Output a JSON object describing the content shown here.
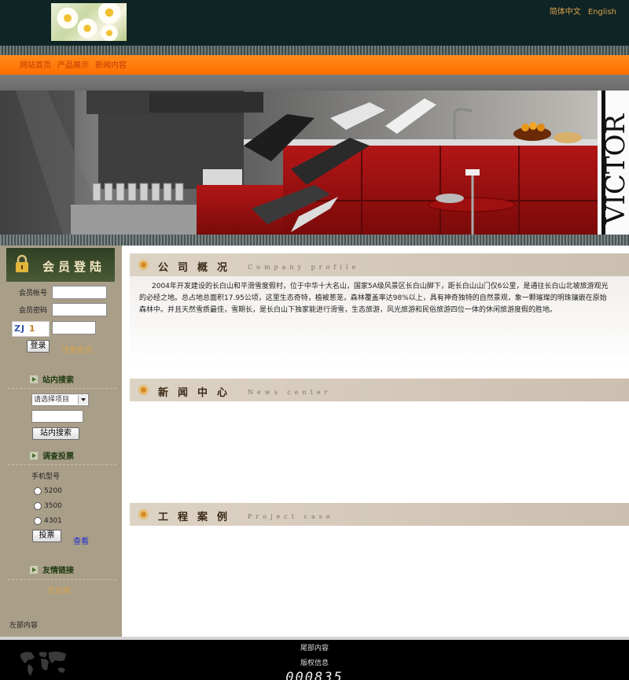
{
  "header": {
    "lang_cn": "简体中文",
    "lang_en": "English"
  },
  "nav": {
    "items": [
      "网站首页",
      "产品展示",
      "新闻内容"
    ]
  },
  "login": {
    "title": "会员登陆",
    "account_label": "会员帐号",
    "password_label": "会员密码",
    "captcha_text": "ZJ",
    "captcha_tail": "1",
    "login_button": "登录",
    "register_link": "注册会员"
  },
  "site_search": {
    "title": "站内搜索",
    "select_value": "请选择项目",
    "button": "站内搜索"
  },
  "survey": {
    "title": "调查投票",
    "question": "手机型号",
    "options": [
      "5200",
      "3500",
      "4301"
    ],
    "vote_button": "投票",
    "view_link": "查看"
  },
  "links": {
    "title": "友情链接",
    "item": "交友网"
  },
  "left_footer": "左部内容",
  "company": {
    "title": "公司概况",
    "subtitle": "Company profile",
    "text": "2004年开发建设的长白山和平滑雪度假村，位于中华十大名山，国家5A级风景区长白山脚下，距长白山山门仅6公里，是通往长白山北坡旅游观光的必经之地。总占地总面积17.95公顷，这里生态奇特，植被葱茏，森林覆盖率达98%以上，具有神奇独特的自然景观，象一颗璀璨的明珠镶嵌在原始森林中。并且天然雪质最佳，雪期长，是长白山下独家能进行滑雪，生态旅游，风光旅游和民俗旅游四位一体的休闲旅游度假的胜地。"
  },
  "news": {
    "title": "新闻中心",
    "subtitle": "News center"
  },
  "projects": {
    "title": "工程案例",
    "subtitle": "Project case"
  },
  "footer": {
    "line1": "尾部内容",
    "line2": "版权信息",
    "counter": "000835"
  },
  "colors": {
    "header_bg": "#0f2424",
    "nav_orange": "#ff7a0a",
    "left_bg": "#a99e88",
    "accent_gold": "#d6a44a"
  }
}
